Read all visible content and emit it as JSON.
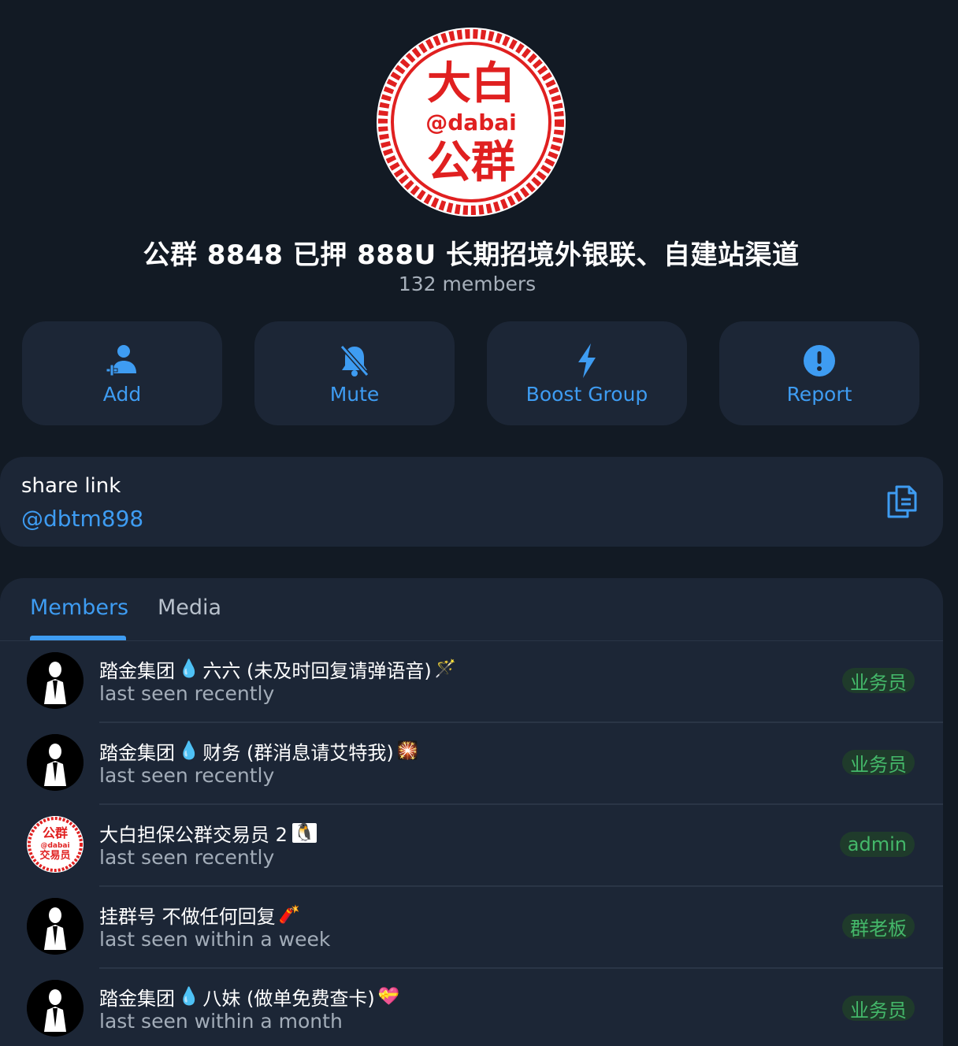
{
  "group": {
    "logo_text_top": "大白",
    "logo_handle": "@dabai",
    "logo_text_bottom": "公群",
    "title": "公群 8848 已押 888U 长期招境外银联、自建站渠道",
    "members_count": "132 members"
  },
  "actions": [
    {
      "label": "Add",
      "icon": "add-user-icon"
    },
    {
      "label": "Mute",
      "icon": "bell-muted-icon"
    },
    {
      "label": "Boost Group",
      "icon": "lightning-icon"
    },
    {
      "label": "Report",
      "icon": "exclamation-circle-icon"
    }
  ],
  "share": {
    "title": "share link",
    "value": "@dbtm898",
    "icon": "copy-icon"
  },
  "tabs": [
    {
      "label": "Members",
      "active": true
    },
    {
      "label": "Media",
      "active": false
    }
  ],
  "members": [
    {
      "name_prefix": "踏金集团",
      "drop": "💧",
      "name_suffix": "六六 (未及时回复请弹语音)",
      "trail": "🪄",
      "status": "last seen recently",
      "role": "业务员"
    },
    {
      "name_prefix": "踏金集团",
      "drop": "💧",
      "name_suffix": "财务 (群消息请艾特我)",
      "trail": "🎇",
      "status": "last seen recently",
      "role": "业务员"
    },
    {
      "name_prefix": "大白担保公群交易员 2",
      "drop": "",
      "name_suffix": "",
      "trail": "🐧",
      "status": "last seen recently",
      "role": "admin",
      "avatar_text_top": "公群",
      "avatar_handle": "@dabai",
      "avatar_text_bottom": "交易员"
    },
    {
      "name_prefix": "挂群号 不做任何回复",
      "drop": "",
      "name_suffix": "",
      "trail": "🧨",
      "status": "last seen within a week",
      "role": "群老板"
    },
    {
      "name_prefix": "踏金集团",
      "drop": "💧",
      "name_suffix": "八妹 (做单免费查卡)",
      "trail": "💝",
      "status": "last seen within a month",
      "role": "业务员"
    }
  ],
  "colors": {
    "background": "#121a24",
    "card": "#1c2636",
    "accent": "#3e9cf2",
    "role_badge_bg": "#1f3b2b",
    "role_badge_text": "#44b86a",
    "logo_red": "#e02020"
  }
}
